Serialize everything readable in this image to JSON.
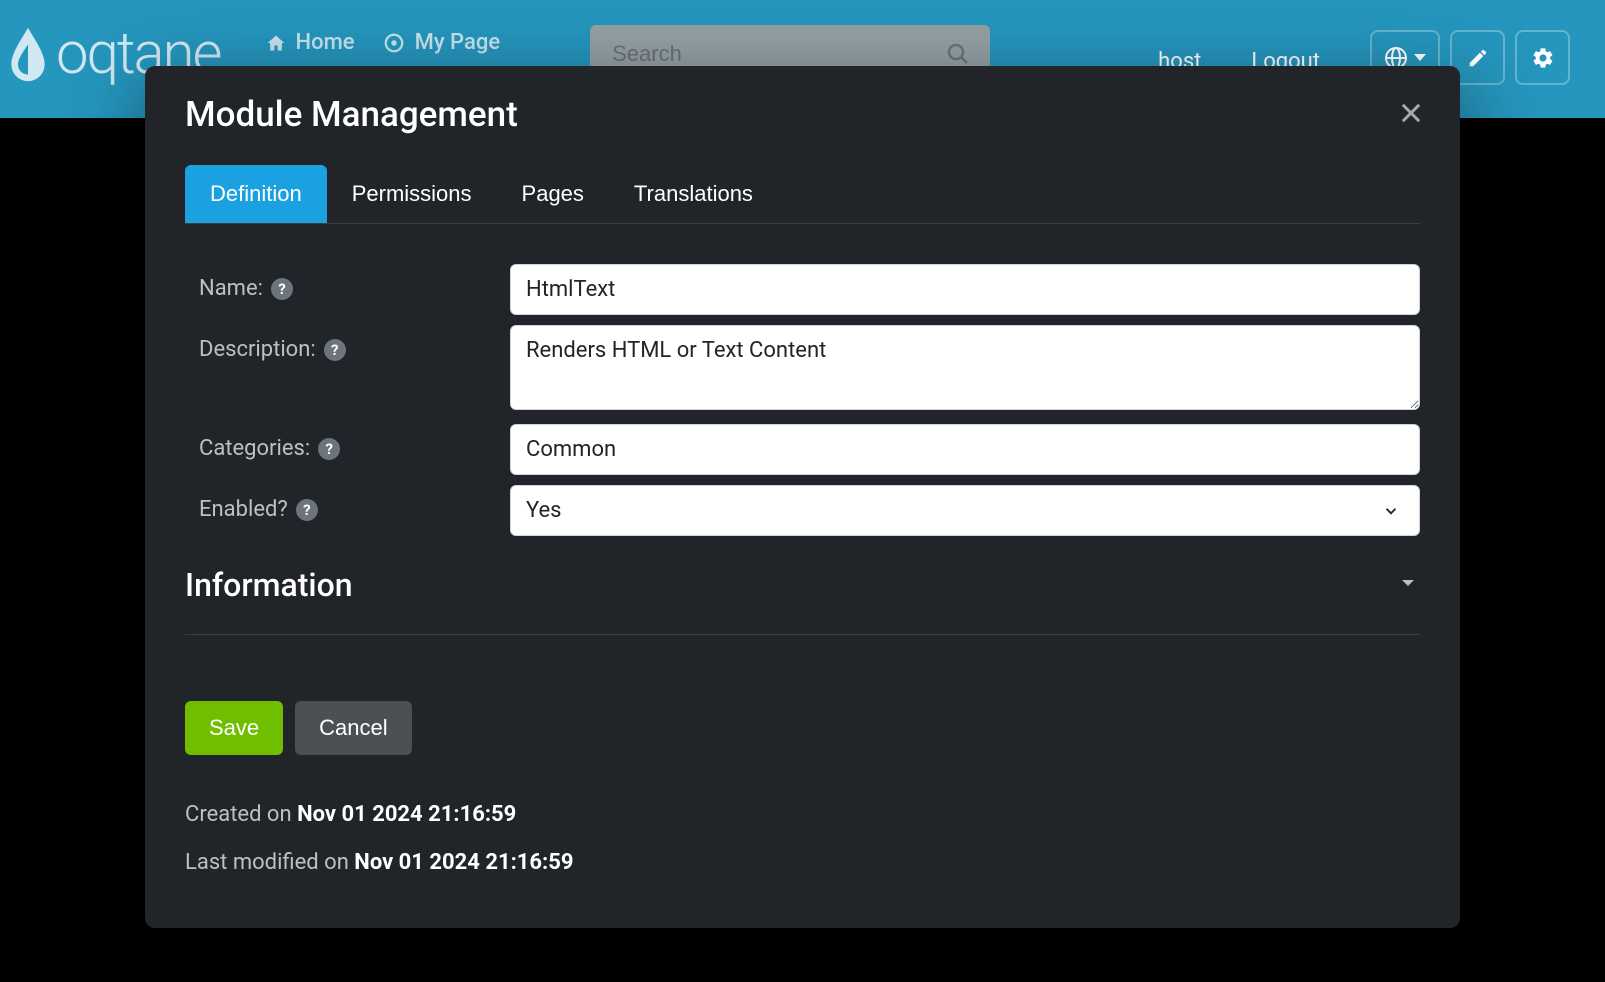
{
  "nav": {
    "home_label": "Home",
    "my_page_label": "My Page",
    "search_placeholder": "Search",
    "user_label": "host",
    "logout_label": "Logout"
  },
  "modal": {
    "title": "Module Management",
    "tabs": {
      "definition": "Definition",
      "permissions": "Permissions",
      "pages": "Pages",
      "translations": "Translations"
    },
    "labels": {
      "name": "Name:",
      "description": "Description:",
      "categories": "Categories:",
      "enabled": "Enabled?"
    },
    "values": {
      "name": "HtmlText",
      "description": "Renders HTML or Text Content",
      "categories": "Common",
      "enabled": "Yes"
    },
    "section_information": "Information",
    "buttons": {
      "save": "Save",
      "cancel": "Cancel"
    },
    "meta": {
      "created_prefix": "Created on ",
      "created_value": "Nov 01 2024 21:16:59",
      "modified_prefix": "Last modified on ",
      "modified_value": "Nov 01 2024 21:16:59"
    }
  }
}
